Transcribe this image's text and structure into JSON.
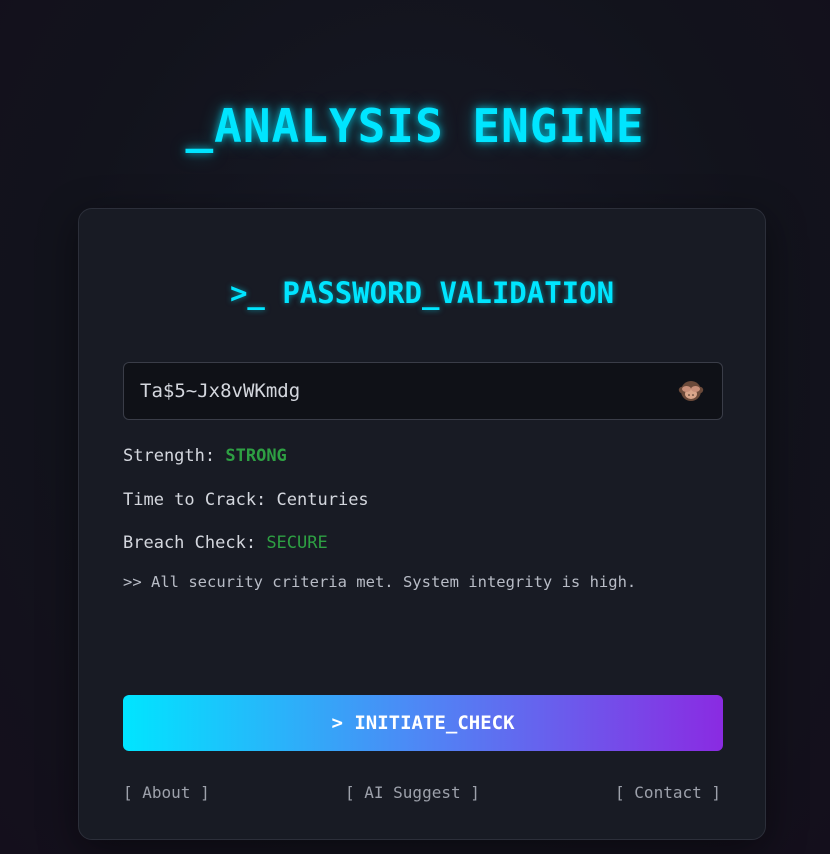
{
  "header": {
    "title": "_ANALYSIS ENGINE"
  },
  "card": {
    "title": ">_ PASSWORD_VALIDATION",
    "password": {
      "value": "Ta$5~Jx8vWKmdg",
      "toggle_icon": "see-no-evil-monkey-icon"
    },
    "strength": {
      "label": "Strength:",
      "value": "STRONG"
    },
    "time_to_crack": {
      "label": "Time to Crack:",
      "value": "Centuries"
    },
    "breach_check": {
      "label": "Breach Check:",
      "value": "SECURE"
    },
    "status_message": ">> All security criteria met. System integrity is high.",
    "action_button": "> INITIATE_CHECK",
    "footer_links": {
      "about": "[ About ]",
      "ai_suggest": "[ AI Suggest ]",
      "contact": "[ Contact ]"
    }
  },
  "colors": {
    "accent": "#00e5ff",
    "success": "#2ea043",
    "gradient_start": "#00e5ff",
    "gradient_end": "#8a2be2",
    "background": "#12131c",
    "card": "#181b24"
  }
}
